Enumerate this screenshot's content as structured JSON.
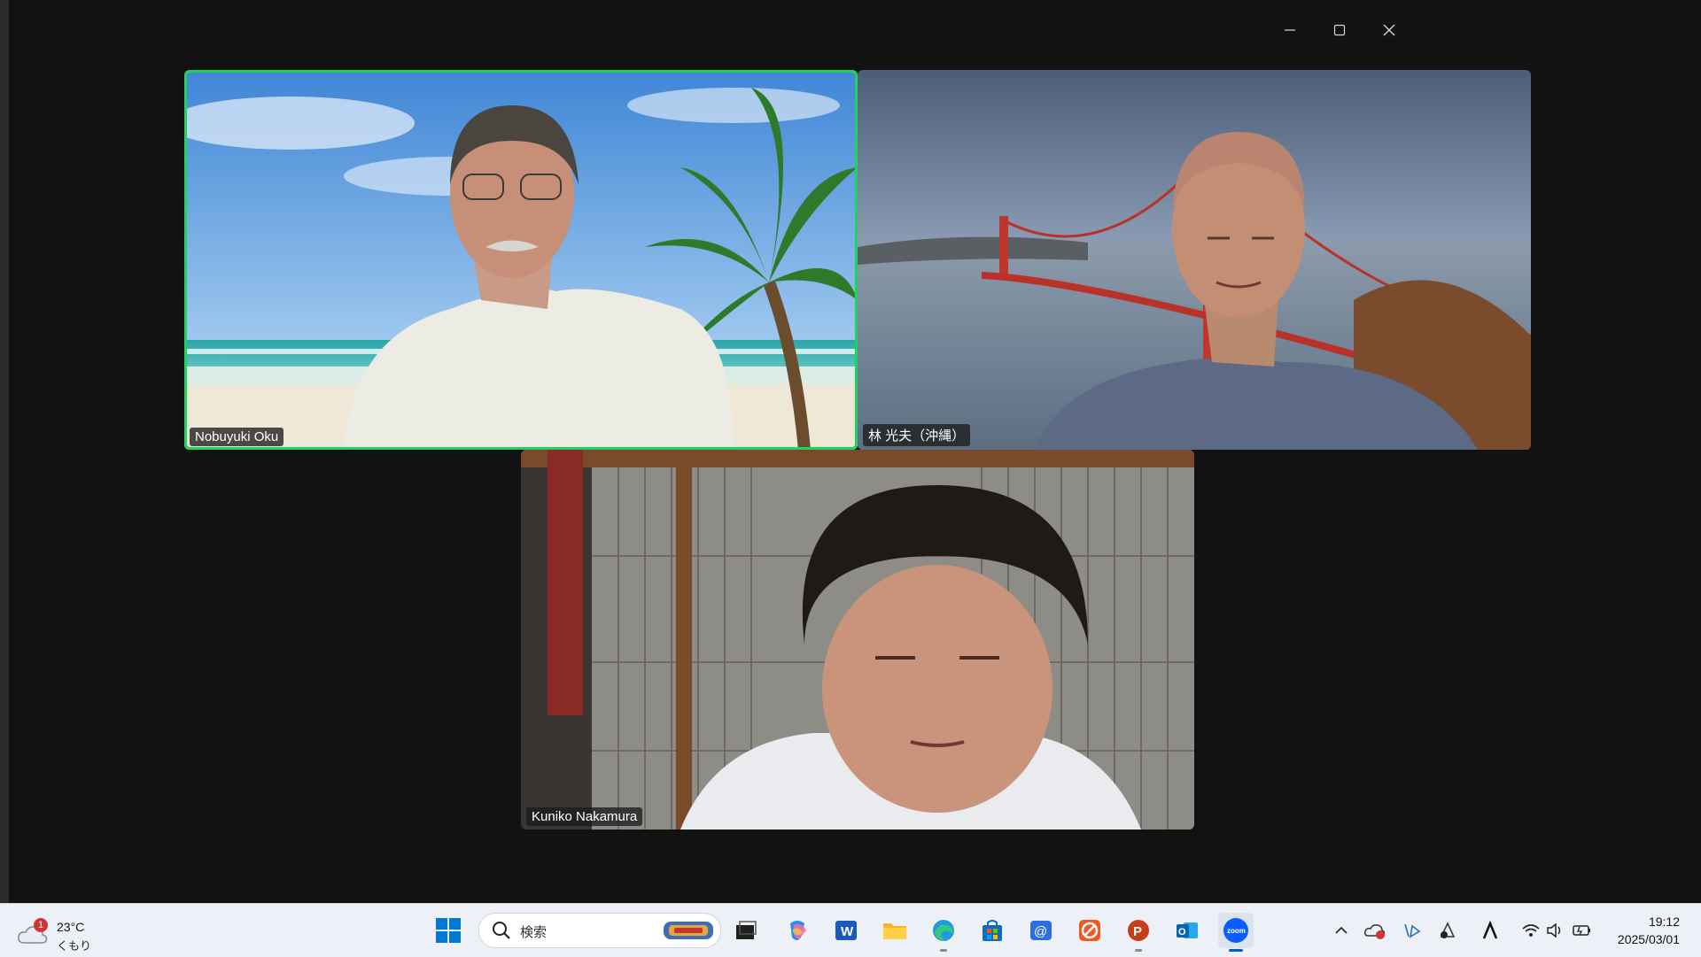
{
  "participants": [
    {
      "name": "Nobuyuki Oku",
      "speaking": true,
      "background": "tropical-beach"
    },
    {
      "name": "林  光夫（沖縄）",
      "speaking": false,
      "background": "golden-gate-bridge"
    },
    {
      "name": "Kuniko Nakamura",
      "speaking": false,
      "background": "shoji-room"
    }
  ],
  "colors": {
    "active_speaker_border": "#23d160",
    "taskbar": "#eef0f8",
    "window_bg": "#121212"
  },
  "window_controls": [
    "minimize-icon",
    "maximize-icon",
    "close-icon"
  ],
  "taskbar": {
    "weather": {
      "badge": "1",
      "temperature": "23°C",
      "condition": "くもり"
    },
    "search_placeholder": "検索",
    "apps": [
      "task-view",
      "copilot",
      "word",
      "file-explorer",
      "edge",
      "microsoft-store",
      "mail",
      "app-orange",
      "powerpoint",
      "outlook",
      "zoom"
    ],
    "zoom_label": "zoom",
    "clock": {
      "time": "19:12",
      "date": "2025/03/01"
    }
  }
}
